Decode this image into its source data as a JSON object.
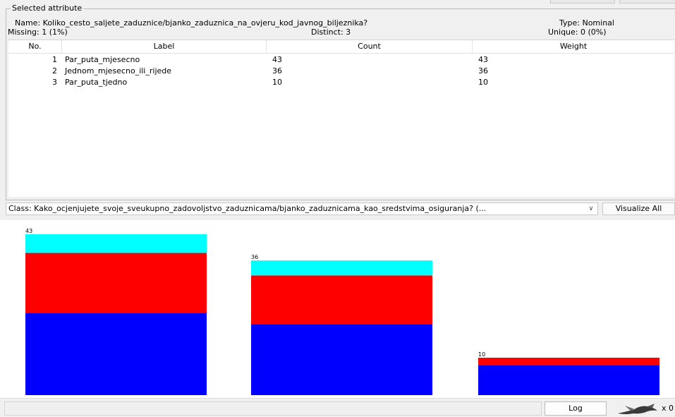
{
  "selected_attribute": {
    "title": "Selected attribute",
    "name_label": "Name: Koliko_cesto_saljete_zaduznice/bjanko_zaduznica_na_ovjeru_kod_javnog_biljeznika?",
    "missing": "Missing: 1 (1%)",
    "distinct": "Distinct: 3",
    "type": "Type: Nominal",
    "unique": "Unique: 0 (0%)"
  },
  "table": {
    "headers": [
      "No.",
      "Label",
      "Count",
      "Weight"
    ],
    "rows": [
      {
        "no": "1",
        "label": "Par_puta_mjesecno",
        "count": "43",
        "weight": "43"
      },
      {
        "no": "2",
        "label": "Jednom_mjesecno_ili_rijede",
        "count": "36",
        "weight": "36"
      },
      {
        "no": "3",
        "label": "Par_puta_tjedno",
        "count": "10",
        "weight": "10"
      }
    ]
  },
  "class_selector": {
    "value": "Class: Kako_ocjenjujete_svoje_sveukupno_zadovoljstvo_zaduznicama/bjanko_zaduznicama_kao_sredstvima_osiguranja? (...",
    "chevron_icon": "chevron-down-icon"
  },
  "visualize_all_label": "Visualize All",
  "log_label": "Log",
  "status_icon": "weka-bird-icon",
  "status_count": "x 0",
  "colors": {
    "blue": "#0000ff",
    "red": "#ff0000",
    "cyan": "#00ffff"
  },
  "chart_data": {
    "type": "bar",
    "stacked": true,
    "categories": [
      "Par_puta_mjesecno",
      "Jednom_mjesecno_ili_rijede",
      "Par_puta_tjedno"
    ],
    "totals": [
      43,
      36,
      10
    ],
    "series": [
      {
        "color": "#0000ff",
        "values": [
          22,
          19,
          8
        ]
      },
      {
        "color": "#ff0000",
        "values": [
          16,
          13,
          2
        ]
      },
      {
        "color": "#00ffff",
        "values": [
          5,
          4,
          0
        ]
      }
    ],
    "ylim": [
      0,
      43
    ]
  }
}
